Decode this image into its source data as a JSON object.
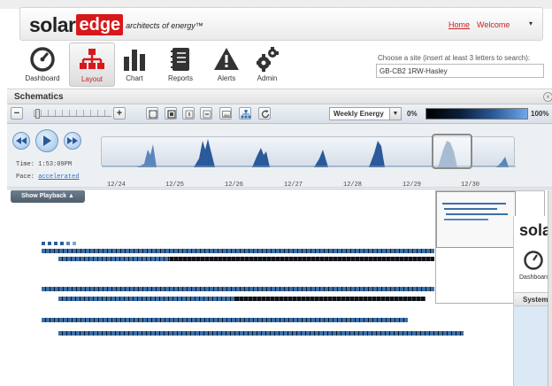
{
  "header": {
    "logo_solar": "solar",
    "logo_edge": "edge",
    "logo_tagline": "architects of energy™",
    "home_link": "Home",
    "welcome": "Welcome",
    "menu_caret": "▾"
  },
  "nav": {
    "items": [
      {
        "label": "Dashboard",
        "icon": "dashboard-icon"
      },
      {
        "label": "Layout",
        "icon": "layout-icon",
        "active": true
      },
      {
        "label": "Chart",
        "icon": "chart-icon"
      },
      {
        "label": "Reports",
        "icon": "reports-icon"
      },
      {
        "label": "Alerts",
        "icon": "alerts-icon"
      },
      {
        "label": "Admin",
        "icon": "admin-icon"
      }
    ]
  },
  "site_search": {
    "label": "Choose a site (insert at least 3 letters to search):",
    "value": "GB-CB2 1RW-Hasley"
  },
  "schematics": {
    "title": "Schematics",
    "close": "×"
  },
  "toolbar": {
    "zoom_out": "−",
    "zoom_in": "+",
    "energy_select": "Weekly Energy",
    "energy_arrow": "▼",
    "scale_min": "0%",
    "scale_max": "100%"
  },
  "playback": {
    "time_label": "Time:",
    "time_value": "1:53:09PM",
    "pace_label": "Pace:",
    "pace_value": "accelerated",
    "dates": [
      "12/24",
      "12/25",
      "12/26",
      "12/27",
      "12/28",
      "12/29",
      "12/30"
    ],
    "show_playback": "Show Playback ▲"
  },
  "preview": {
    "logo": "sola",
    "dashboard": "Dashboard",
    "system": "System"
  },
  "colors": {
    "brand_red": "#d7191c",
    "panel_blue": "#3c6fa8",
    "panel_dark": "#0f1217"
  }
}
